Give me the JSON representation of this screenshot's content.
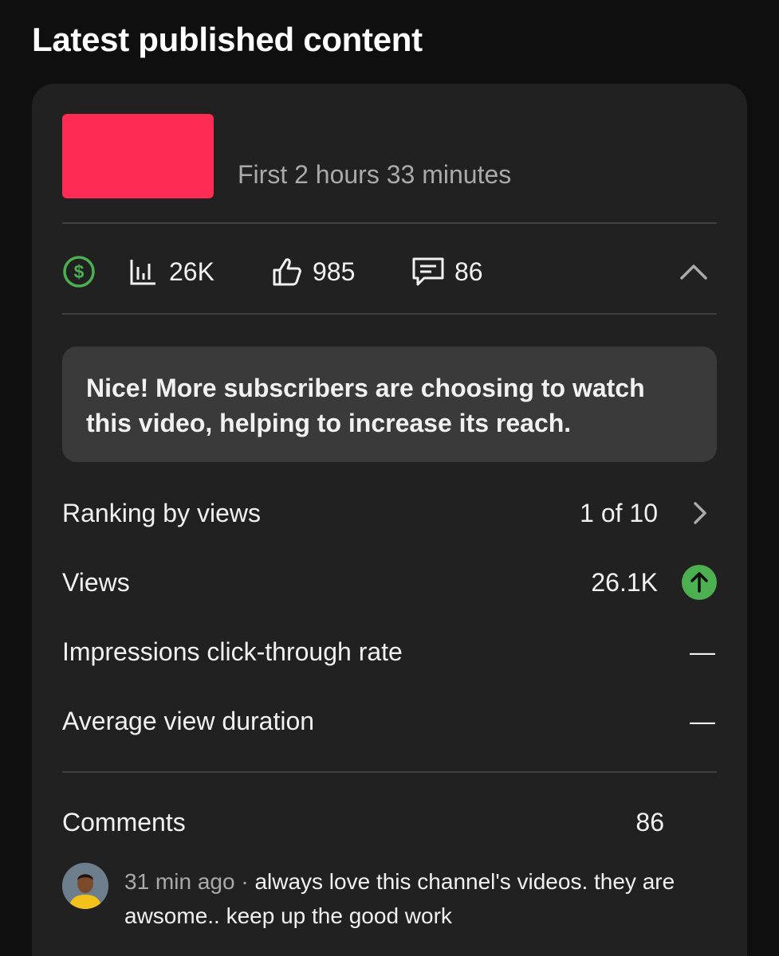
{
  "section_title": "Latest published content",
  "video": {
    "period": "First 2 hours 33 minutes"
  },
  "stats": {
    "monetization_icon": "dollar-circle-icon",
    "monetization_color": "#4caf50",
    "views": "26K",
    "likes": "985",
    "comments": "86"
  },
  "insight_message": "Nice! More subscribers are choosing to watch this video, helping to increase its reach.",
  "metrics": {
    "ranking": {
      "label": "Ranking by views",
      "value": "1 of 10"
    },
    "views": {
      "label": "Views",
      "value": "26.1K",
      "trend": "up",
      "trend_color": "#4caf50"
    },
    "ctr": {
      "label": "Impressions click-through rate",
      "value": "—"
    },
    "avd": {
      "label": "Average view duration",
      "value": "—"
    }
  },
  "comments_section": {
    "label": "Comments",
    "count": "86",
    "latest": {
      "time": "31 min ago",
      "separator": " · ",
      "text": "always love this channel's videos. they are awsome.. keep up the good work"
    }
  }
}
